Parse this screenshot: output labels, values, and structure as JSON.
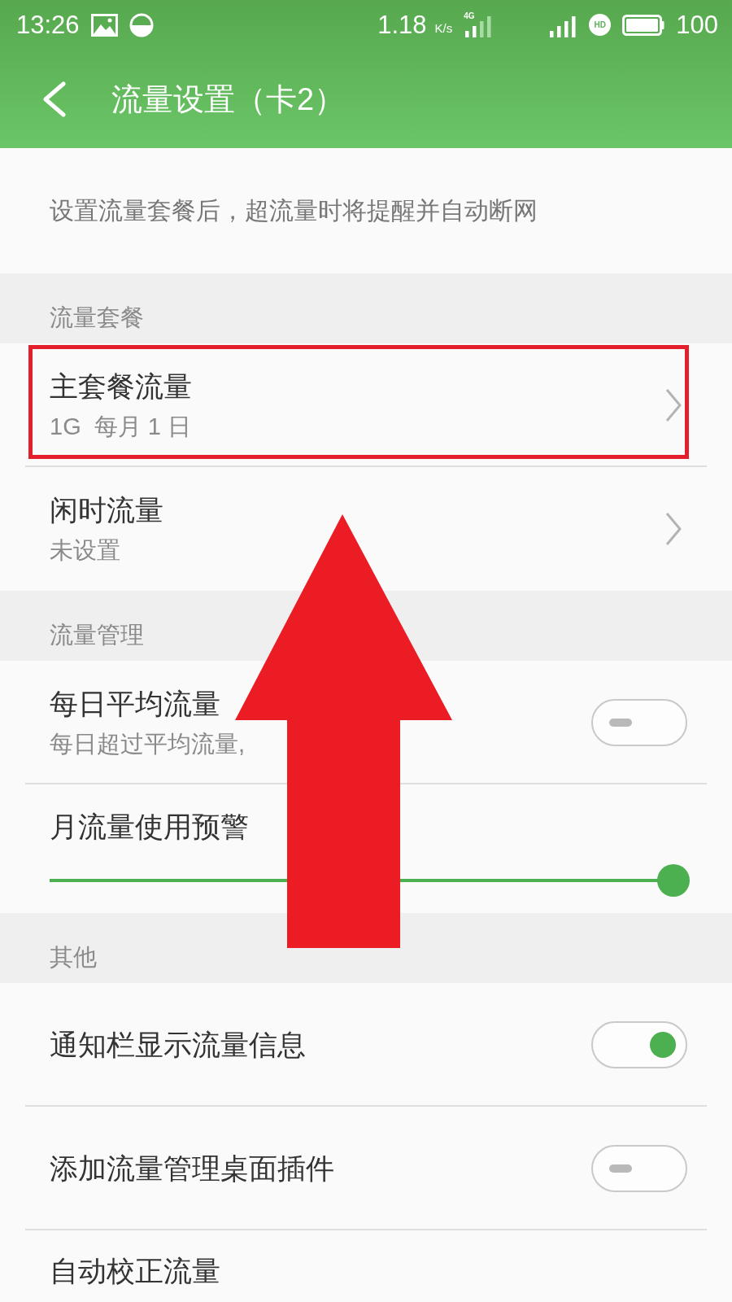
{
  "status_bar": {
    "time": "13:26",
    "speed": "1.18",
    "speed_unit": "K/s",
    "network": "4G",
    "hd": "HD",
    "battery": "100"
  },
  "header": {
    "title": "流量设置（卡2）"
  },
  "intro": "设置流量套餐后，超流量时将提醒并自动断网",
  "sections": [
    {
      "title": "流量套餐",
      "rows": [
        {
          "kind": "link",
          "title": "主套餐流量",
          "subtitle": "1G  每月 1 日",
          "highlighted": true
        },
        {
          "kind": "link",
          "title": "闲时流量",
          "subtitle": "未设置",
          "highlighted": false
        }
      ]
    },
    {
      "title": "流量管理",
      "rows": [
        {
          "kind": "toggle",
          "title": "每日平均流量",
          "subtitle": "每日超过平均流量,",
          "on": false,
          "highlighted": false
        },
        {
          "kind": "slider",
          "title": "月流量使用预警",
          "level": 1,
          "highlighted": false
        }
      ]
    },
    {
      "title": "其他",
      "rows": [
        {
          "kind": "toggle",
          "title": "通知栏显示流量信息",
          "on": true,
          "highlighted": false
        },
        {
          "kind": "toggle",
          "title": "添加流量管理桌面插件",
          "on": false,
          "highlighted": false
        },
        {
          "kind": "plain",
          "title": "自动校正流量",
          "highlighted": false
        }
      ]
    }
  ]
}
